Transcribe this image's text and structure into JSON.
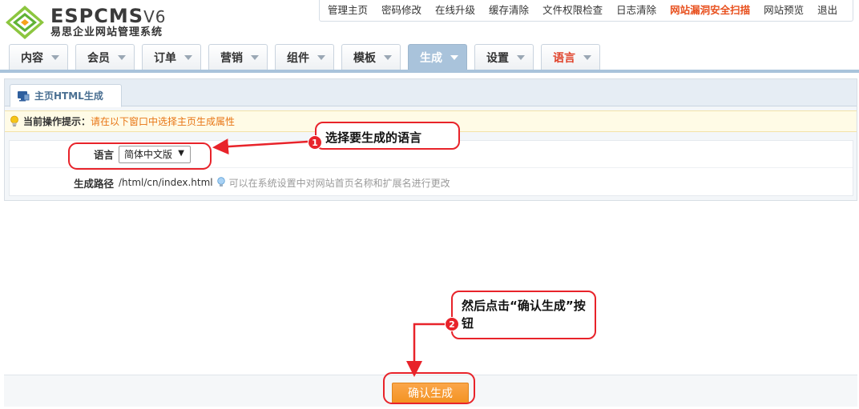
{
  "brand": {
    "name": "ESPCMS",
    "version": "V6",
    "subtitle": "易思企业网站管理系统"
  },
  "toplinks": [
    {
      "label": "管理主页",
      "style": "normal"
    },
    {
      "label": "密码修改",
      "style": "normal"
    },
    {
      "label": "在线升级",
      "style": "normal"
    },
    {
      "label": "缓存清除",
      "style": "normal"
    },
    {
      "label": "文件权限检查",
      "style": "normal"
    },
    {
      "label": "日志清除",
      "style": "normal"
    },
    {
      "label": "网站漏洞安全扫描",
      "style": "warn"
    },
    {
      "label": "网站预览",
      "style": "normal"
    },
    {
      "label": "退出",
      "style": "normal"
    }
  ],
  "nav": [
    {
      "label": "内容"
    },
    {
      "label": "会员"
    },
    {
      "label": "订单"
    },
    {
      "label": "营销"
    },
    {
      "label": "组件"
    },
    {
      "label": "模板"
    },
    {
      "label": "生成",
      "active": true
    },
    {
      "label": "设置"
    },
    {
      "label": "语言",
      "highlight": true
    }
  ],
  "subtab": {
    "label": "主页HTML生成"
  },
  "tip": {
    "label": "当前操作提示：",
    "message": "请在以下窗口中选择主页生成属性"
  },
  "form": {
    "language_label": "语言",
    "language_value": "简体中文版",
    "path_label": "生成路径",
    "path_value": "/html/cn/index.html",
    "path_hint": "可以在系统设置中对网站首页名称和扩展名进行更改"
  },
  "confirm_label": "确认生成",
  "annotations": {
    "step1_number": "1",
    "step1_text": "选择要生成的语言",
    "step2_number": "2",
    "step2_text": "然后点击“确认生成”按钮"
  },
  "colors": {
    "accent_orange": "#f39322",
    "warn_red": "#e8501e",
    "tip_orange": "#e87514",
    "annotation_red": "#e8232a",
    "nav_active": "#a9c3db"
  }
}
